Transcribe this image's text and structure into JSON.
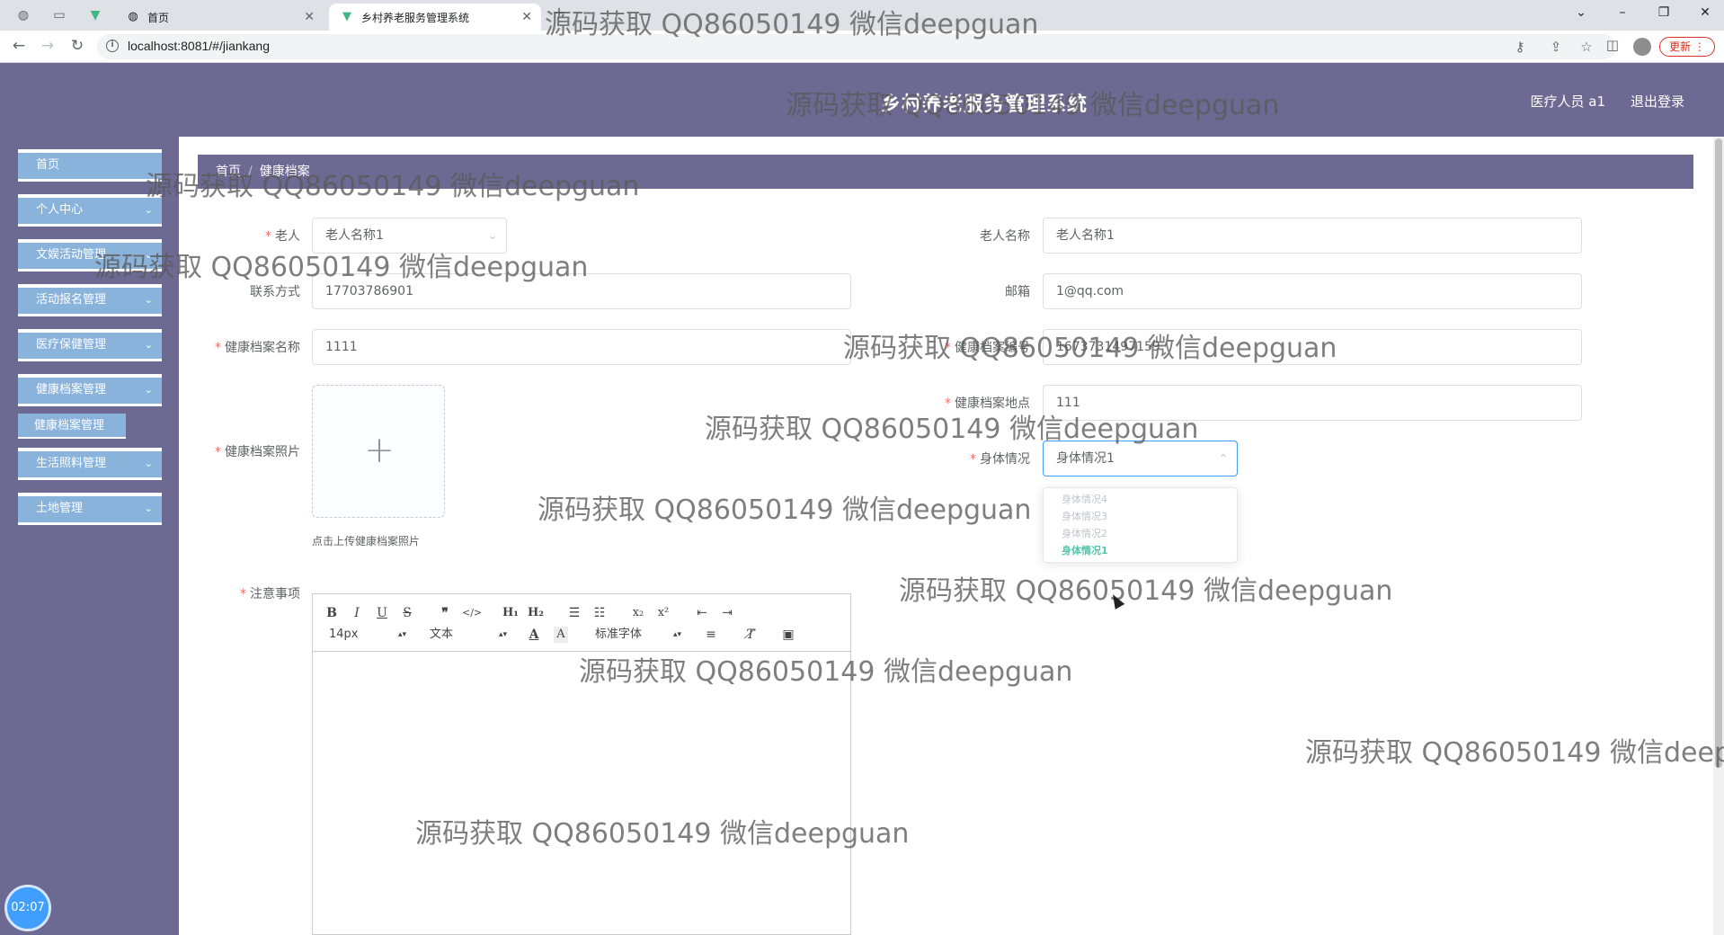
{
  "browser": {
    "tabs": [
      {
        "label": "",
        "icon": "globe-icon"
      },
      {
        "label": "",
        "icon": "blank-page-icon"
      },
      {
        "label": "",
        "icon": "vue-logo-icon"
      },
      {
        "label": "首页",
        "icon": "globe-icon"
      },
      {
        "label": "乡村养老服务管理系统",
        "icon": "vue-logo-icon"
      }
    ],
    "url": "localhost:8081/#/jiankang",
    "update_label": "更新"
  },
  "header": {
    "title": "乡村养老服务管理系统",
    "user_role": "医疗人员 a1",
    "logout": "退出登录"
  },
  "sidebar": {
    "items": [
      {
        "label": "首页",
        "has_children": false
      },
      {
        "label": "个人中心",
        "has_children": true
      },
      {
        "label": "文娱活动管理",
        "has_children": true
      },
      {
        "label": "活动报名管理",
        "has_children": true
      },
      {
        "label": "医疗保健管理",
        "has_children": true
      },
      {
        "label": "健康档案管理",
        "has_children": true
      },
      {
        "label": "生活照料管理",
        "has_children": true
      },
      {
        "label": "土地管理",
        "has_children": true
      }
    ],
    "sub_item": "健康档案管理",
    "clock": "02:07"
  },
  "breadcrumb": {
    "home": "首页",
    "separator": "/",
    "current": "健康档案"
  },
  "form": {
    "elder": {
      "label": "老人",
      "value": "老人名称1"
    },
    "elder_name": {
      "label": "老人名称",
      "value": "老人名称1"
    },
    "phone": {
      "label": "联系方式",
      "value": "17703786901"
    },
    "email": {
      "label": "邮箱",
      "value": "1@qq.com"
    },
    "record_name": {
      "label": "健康档案名称",
      "value": "1111"
    },
    "record_no": {
      "label": "健康档案编号",
      "value": "1673731497159"
    },
    "record_location": {
      "label": "健康档案地点",
      "value": "111"
    },
    "photo": {
      "label": "健康档案照片",
      "tip": "点击上传健康档案照片"
    },
    "health": {
      "label": "身体情况",
      "value": "身体情况1",
      "options": [
        "身体情况4",
        "身体情况3",
        "身体情况2",
        "身体情况1"
      ],
      "selected_index": 3
    },
    "notes": {
      "label": "注意事项"
    }
  },
  "editor": {
    "font_size": "14px",
    "heading": "文本",
    "font_family": "标准字体",
    "buttons": [
      "bold-icon",
      "italic-icon",
      "underline-icon",
      "strike-icon",
      "blockquote-icon",
      "code-block-icon",
      "h1-icon",
      "h2-icon",
      "ordered-list-icon",
      "bullet-list-icon",
      "subscript-icon",
      "superscript-icon",
      "outdent-icon",
      "indent-icon",
      "font-color-icon",
      "background-color-icon",
      "align-icon",
      "clear-format-icon",
      "image-icon"
    ]
  },
  "watermark": "源码获取 QQ86050149 微信deepguan",
  "colors": {
    "header_bg": "#6c6a93",
    "menu_item_bg": "#8ab3dc",
    "required": "#f56c6c",
    "selected_option": "#55c6a9",
    "clock_bg": "#409eff"
  }
}
